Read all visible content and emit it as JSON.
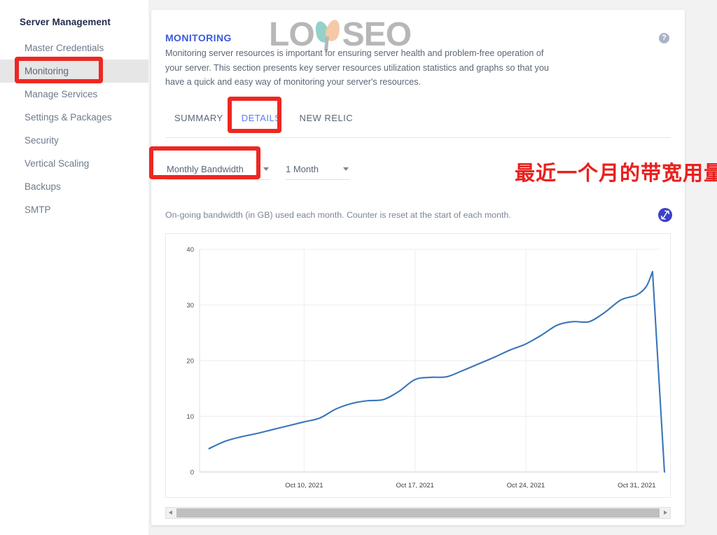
{
  "sidebar": {
    "title": "Server Management",
    "items": [
      {
        "label": "Master Credentials",
        "active": false
      },
      {
        "label": "Monitoring",
        "active": true
      },
      {
        "label": "Manage Services",
        "active": false
      },
      {
        "label": "Settings & Packages",
        "active": false
      },
      {
        "label": "Security",
        "active": false
      },
      {
        "label": "Vertical Scaling",
        "active": false
      },
      {
        "label": "Backups",
        "active": false
      },
      {
        "label": "SMTP",
        "active": false
      }
    ]
  },
  "panel": {
    "title": "MONITORING",
    "description": "Monitoring server resources is important for ensuring server health and problem-free operation of your server. This section presents key server resources utilization statistics and graphs so that you have a quick and easy way of monitoring your server's resources.",
    "help_icon": "help-circle-icon",
    "accent_color": "#3b5bdb"
  },
  "logo": {
    "text_left": "LO",
    "text_right": "SEO",
    "petal_left_color": "#8fcfc6",
    "petal_right_color": "#f5c7a3",
    "text_color": "#b4b4b4"
  },
  "tabs": [
    {
      "label": "SUMMARY",
      "active": false
    },
    {
      "label": "DETAILS",
      "active": true
    },
    {
      "label": "NEW RELIC",
      "active": false
    }
  ],
  "controls": {
    "metric_select": {
      "value": "Monthly Bandwidth",
      "caret": "chevron-down-icon"
    },
    "period_select": {
      "value": "1 Month",
      "caret": "chevron-down-icon"
    }
  },
  "annotations": {
    "chinese_note": "最近一个月的带宽用量累计值",
    "note_color": "#e8211f",
    "boxes": [
      {
        "target": "Monitoring"
      },
      {
        "target": "DETAILS"
      },
      {
        "target": "Monthly Bandwidth"
      }
    ]
  },
  "chart_section": {
    "description": "On-going bandwidth (in GB) used each month. Counter is reset at the start of each month.",
    "refresh_icon": "refresh-icon",
    "refresh_color": "#3b40c9"
  },
  "scrollbar": {
    "left_arrow": "chevron-left-icon",
    "right_arrow": "chevron-right-icon"
  },
  "chart_data": {
    "type": "line",
    "title": "",
    "xlabel": "",
    "ylabel": "",
    "ylim": [
      0,
      40
    ],
    "yticks": [
      0,
      10,
      20,
      30,
      40
    ],
    "grid": true,
    "legend": false,
    "line_color": "#3a76b8",
    "x_tick_labels": [
      "Oct 10, 2021",
      "Oct 17, 2021",
      "Oct 24, 2021",
      "Oct 31, 2021"
    ],
    "x_tick_positions": [
      10,
      17,
      24,
      31
    ],
    "x": [
      4,
      5,
      6,
      7,
      8,
      9,
      10,
      11,
      12,
      13,
      14,
      15,
      16,
      17,
      18,
      19,
      20,
      21,
      22,
      23,
      24,
      25,
      26,
      27,
      28,
      29,
      30,
      31,
      31.6,
      32
    ],
    "series": [
      {
        "name": "Monthly Bandwidth (GB)",
        "values": [
          4.2,
          5.5,
          6.3,
          6.9,
          7.6,
          8.3,
          9.0,
          9.7,
          11.3,
          12.3,
          12.8,
          13.0,
          14.5,
          16.6,
          17.0,
          17.1,
          18.2,
          19.4,
          20.6,
          21.9,
          23.0,
          24.6,
          26.4,
          27.0,
          27.0,
          28.7,
          30.9,
          31.8,
          33.3,
          36.0
        ]
      }
    ],
    "annotations": [
      "sharp drop to 0 at month reset after peak of 36"
    ]
  }
}
